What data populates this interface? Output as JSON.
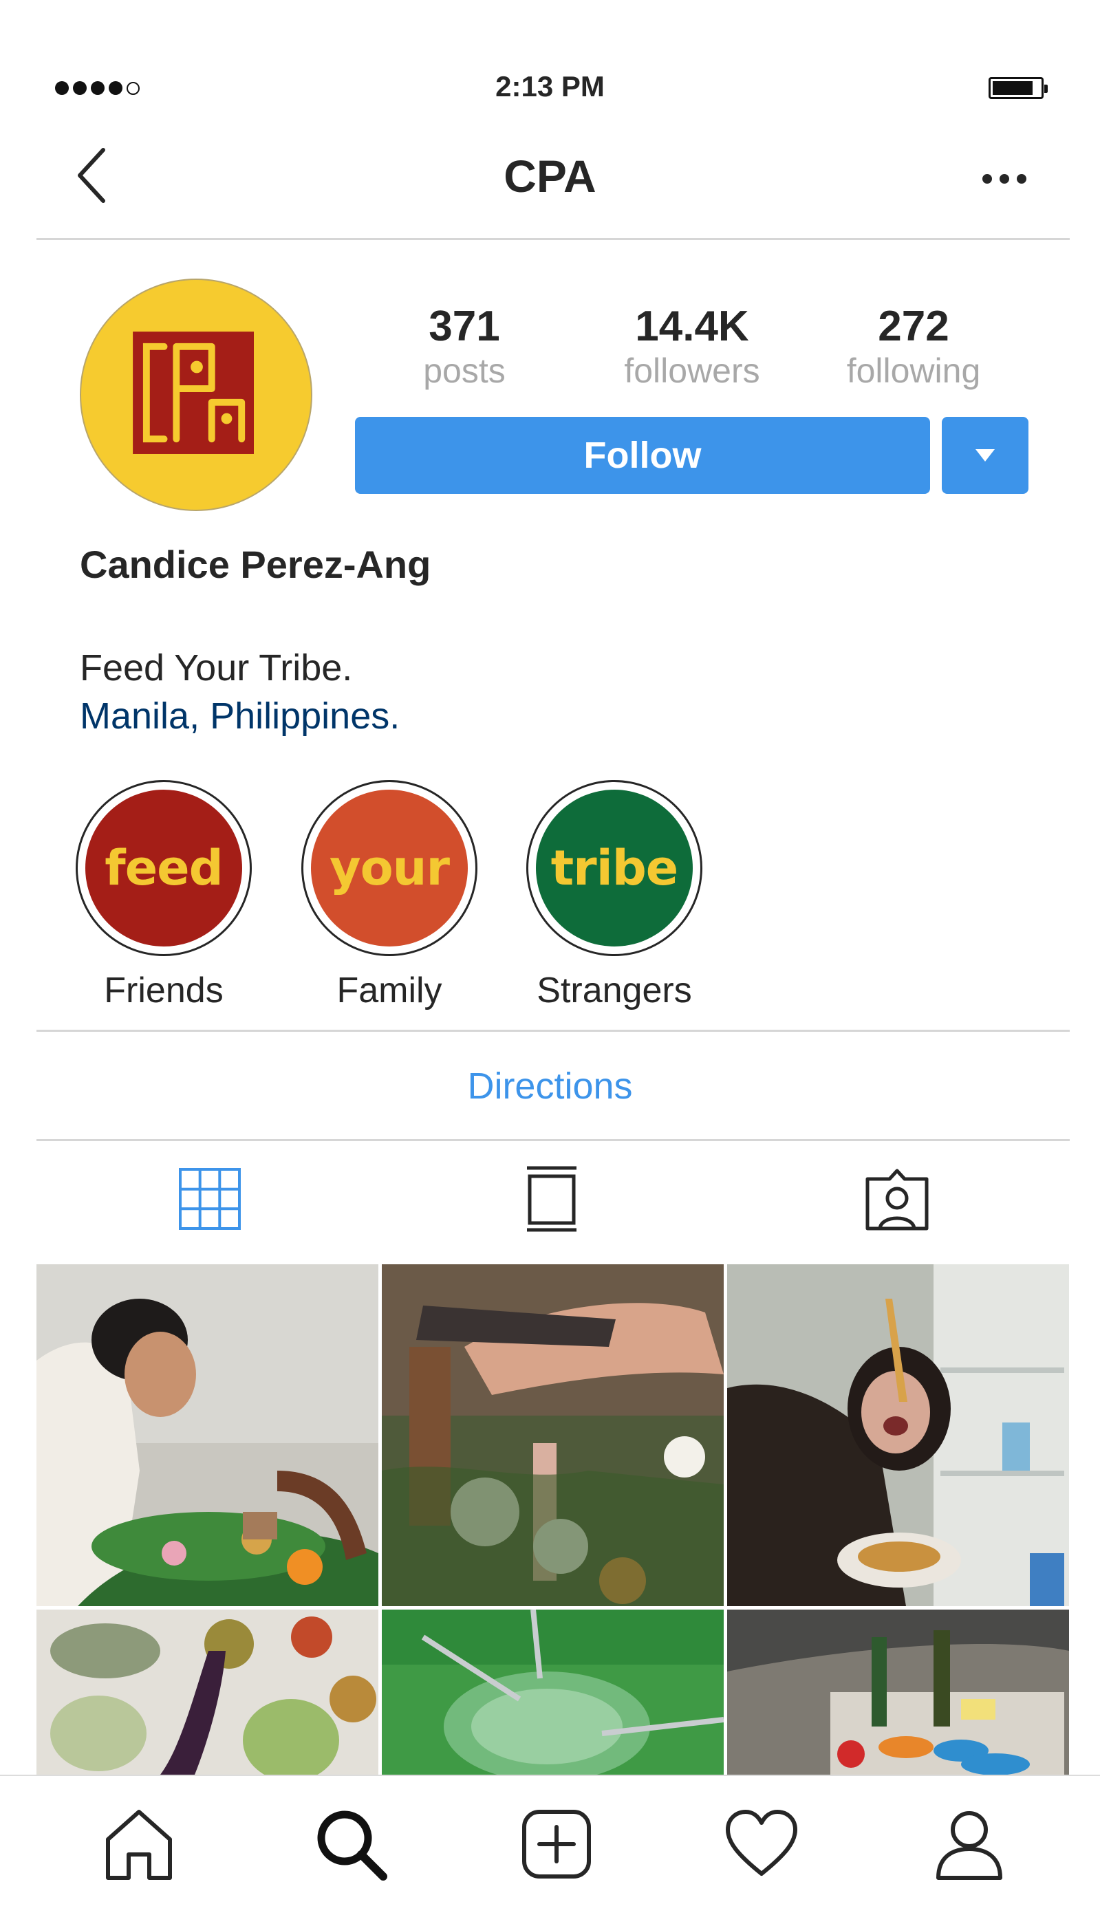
{
  "status_bar": {
    "time": "2:13 PM",
    "signal_bars": 4,
    "signal_total": 5,
    "battery_level": 0.8
  },
  "nav": {
    "title": "CPA",
    "back_icon": "chevron-left-icon",
    "more_icon": "ellipsis-icon"
  },
  "profile": {
    "stats": [
      {
        "value": "371",
        "label": "posts"
      },
      {
        "value": "14.4K",
        "label": "followers"
      },
      {
        "value": "272",
        "label": "following"
      }
    ],
    "follow_label": "Follow",
    "name": "Candice Perez-Ang",
    "bio": "Feed Your Tribe.",
    "location": "Manila, Philippines."
  },
  "highlights": [
    {
      "word": "feed",
      "label": "Friends",
      "color": "#a41e17"
    },
    {
      "word": "your",
      "label": "Family",
      "color": "#d24e2c"
    },
    {
      "word": "tribe",
      "label": "Strangers",
      "color": "#0e6c3a"
    }
  ],
  "directions_label": "Directions",
  "tabs": [
    "grid-icon",
    "feed-icon",
    "tagged-icon"
  ],
  "bottom_nav": [
    "home-icon",
    "search-icon",
    "add-post-icon",
    "heart-icon",
    "profile-icon"
  ],
  "colors": {
    "accent": "#3d94ea",
    "link": "#003569",
    "avatar_bg": "#f6cb2f",
    "avatar_mark": "#a41e17"
  }
}
